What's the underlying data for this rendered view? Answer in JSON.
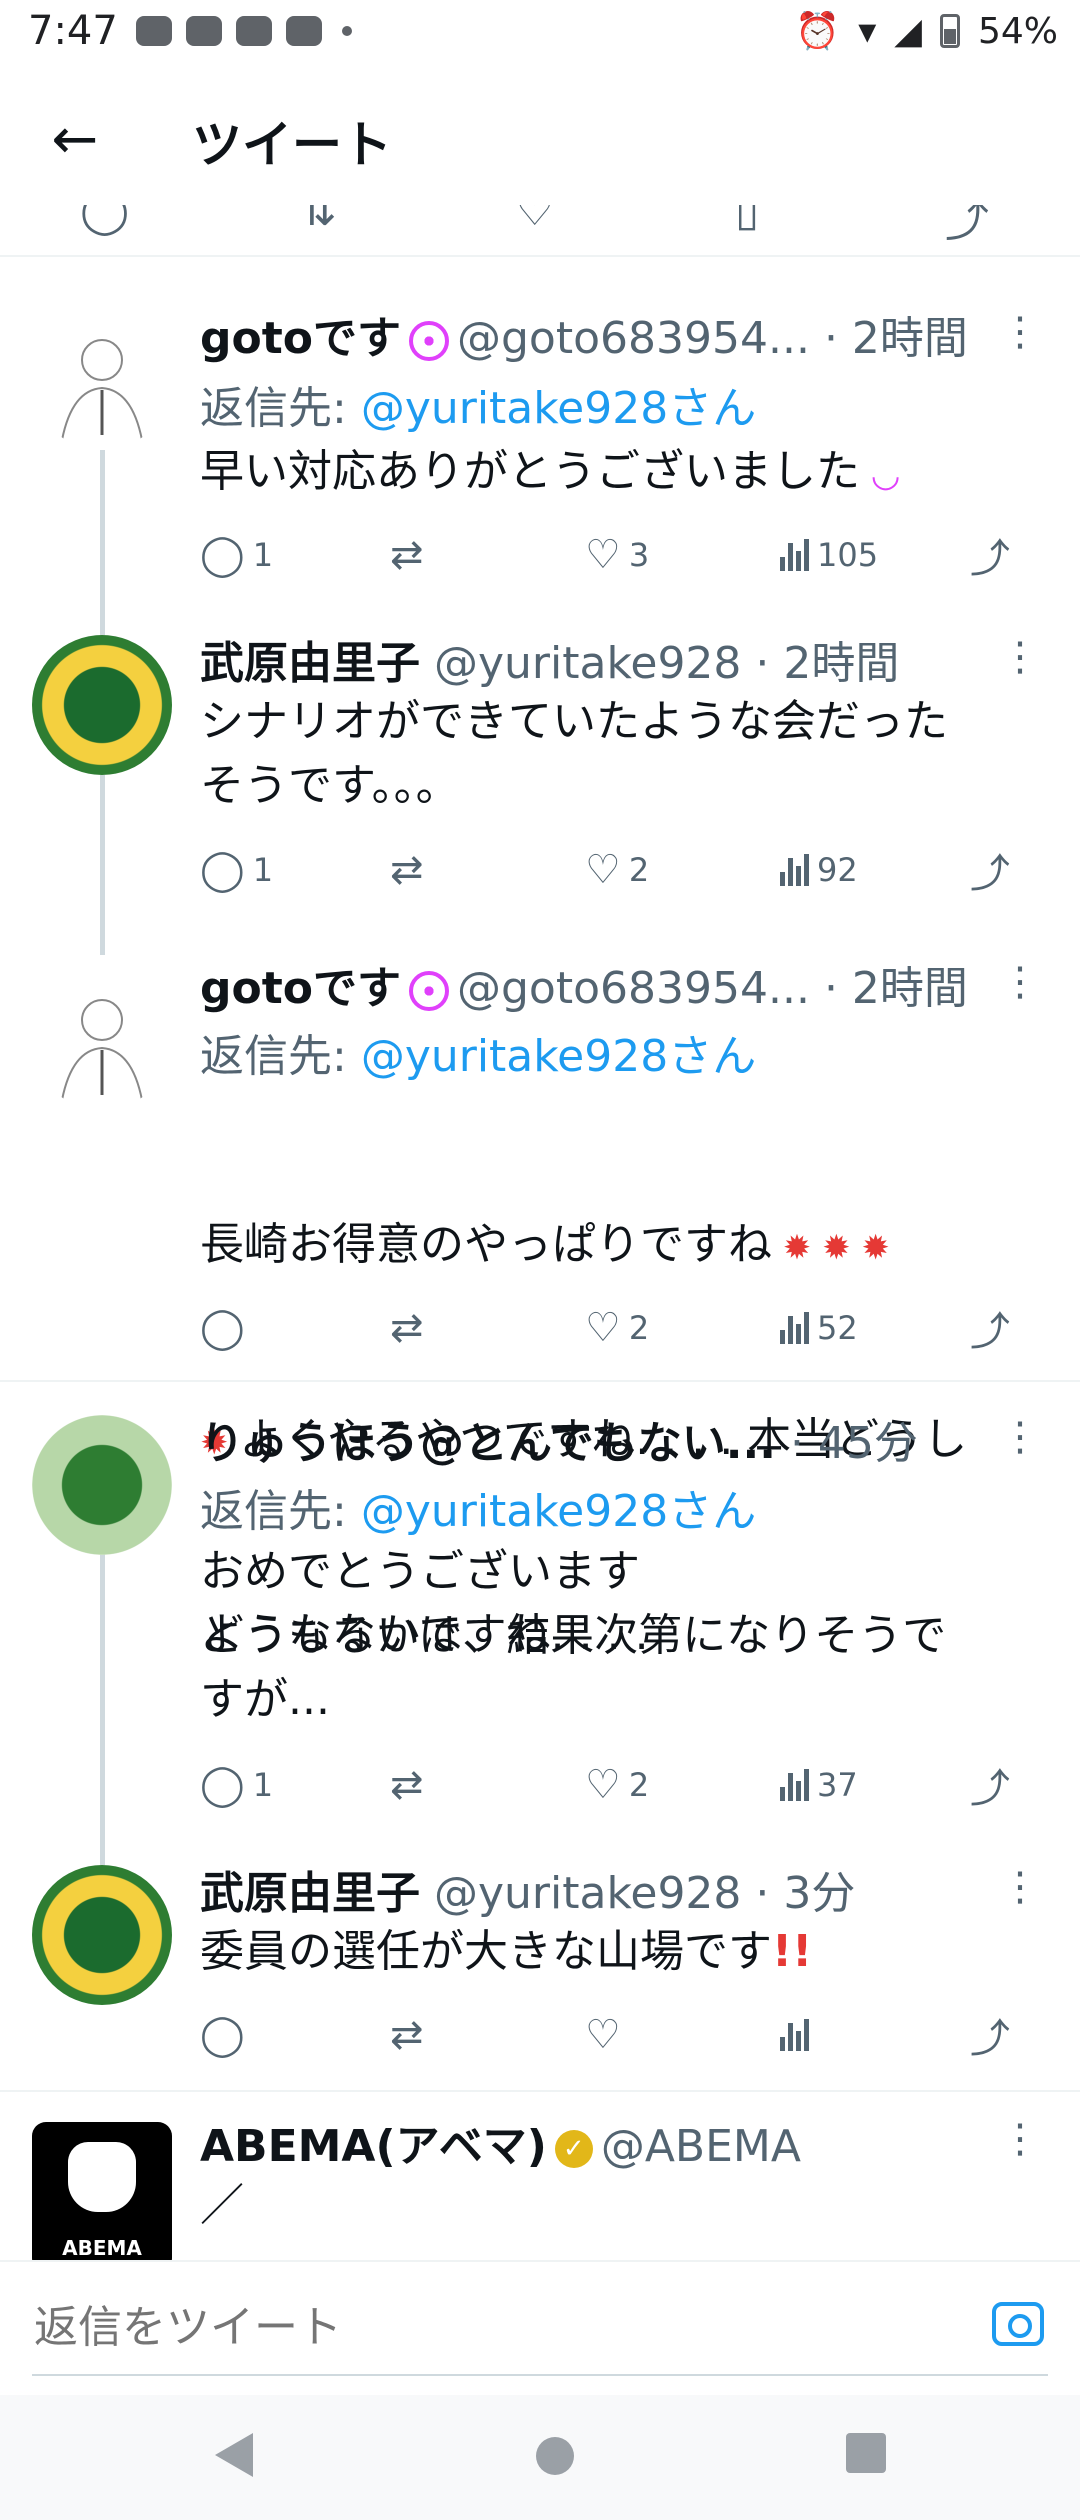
{
  "status_bar": {
    "time": "7:47",
    "battery": "54%"
  },
  "header": {
    "title": "ツイート"
  },
  "tweets": [
    {
      "name": "gotoです",
      "handle": "@goto683954...",
      "time": "· 2時間",
      "reply_to_prefix": "返信先: ",
      "reply_to": "@yuritake928さん",
      "text": "早い対応ありがとうございました",
      "replies": "1",
      "retweets": "",
      "likes": "3",
      "views": "105"
    },
    {
      "name": "武原由里子",
      "handle": "@yuritake928",
      "time": "· 2時間",
      "text": "シナリオができていたような会だった\nそうです。。。",
      "replies": "1",
      "retweets": "",
      "likes": "2",
      "views": "92"
    },
    {
      "name": "gotoです",
      "handle": "@goto683954...",
      "time": "· 2時間",
      "reply_to_prefix": "返信先: ",
      "reply_to": "@yuritake928さん",
      "text_line1": "長崎お得意のやっぱりですね",
      "text_line2": "よくやるやつですね. . . . 本当どうし",
      "text_line3": "ようもないですね. . . .",
      "replies": "",
      "retweets": "",
      "likes": "2",
      "views": "52"
    },
    {
      "name": "りゅうほう@とんでもない...",
      "handle": "",
      "time": "· 45分",
      "reply_to_prefix": "返信先: ",
      "reply_to": "@yuritake928さん",
      "text": "おめでとうございます\nどうなるかは、結果次第になりそうで\nすが...",
      "replies": "1",
      "retweets": "",
      "likes": "2",
      "views": "37"
    },
    {
      "name": "武原由里子",
      "handle": "@yuritake928",
      "time": "· 3分",
      "text": "委員の選任が大きな山場です",
      "replies": "",
      "retweets": "",
      "likes": "",
      "views": ""
    },
    {
      "name": "ABEMA(アベマ)",
      "handle": "@ABEMA",
      "time": "",
      "text": "／",
      "avatar_label": "ABEMA"
    }
  ],
  "reply_bar": {
    "placeholder": "返信をツイート"
  },
  "icons": {
    "back": "arrow-left-icon",
    "reply": "comment-icon",
    "retweet": "retweet-icon",
    "like": "heart-icon",
    "views": "bar-chart-icon",
    "share": "share-icon",
    "more": "more-vertical-icon",
    "camera": "camera-icon"
  },
  "colors": {
    "link": "#1d9bf0",
    "secondary": "#536471",
    "text": "#0f1419"
  }
}
